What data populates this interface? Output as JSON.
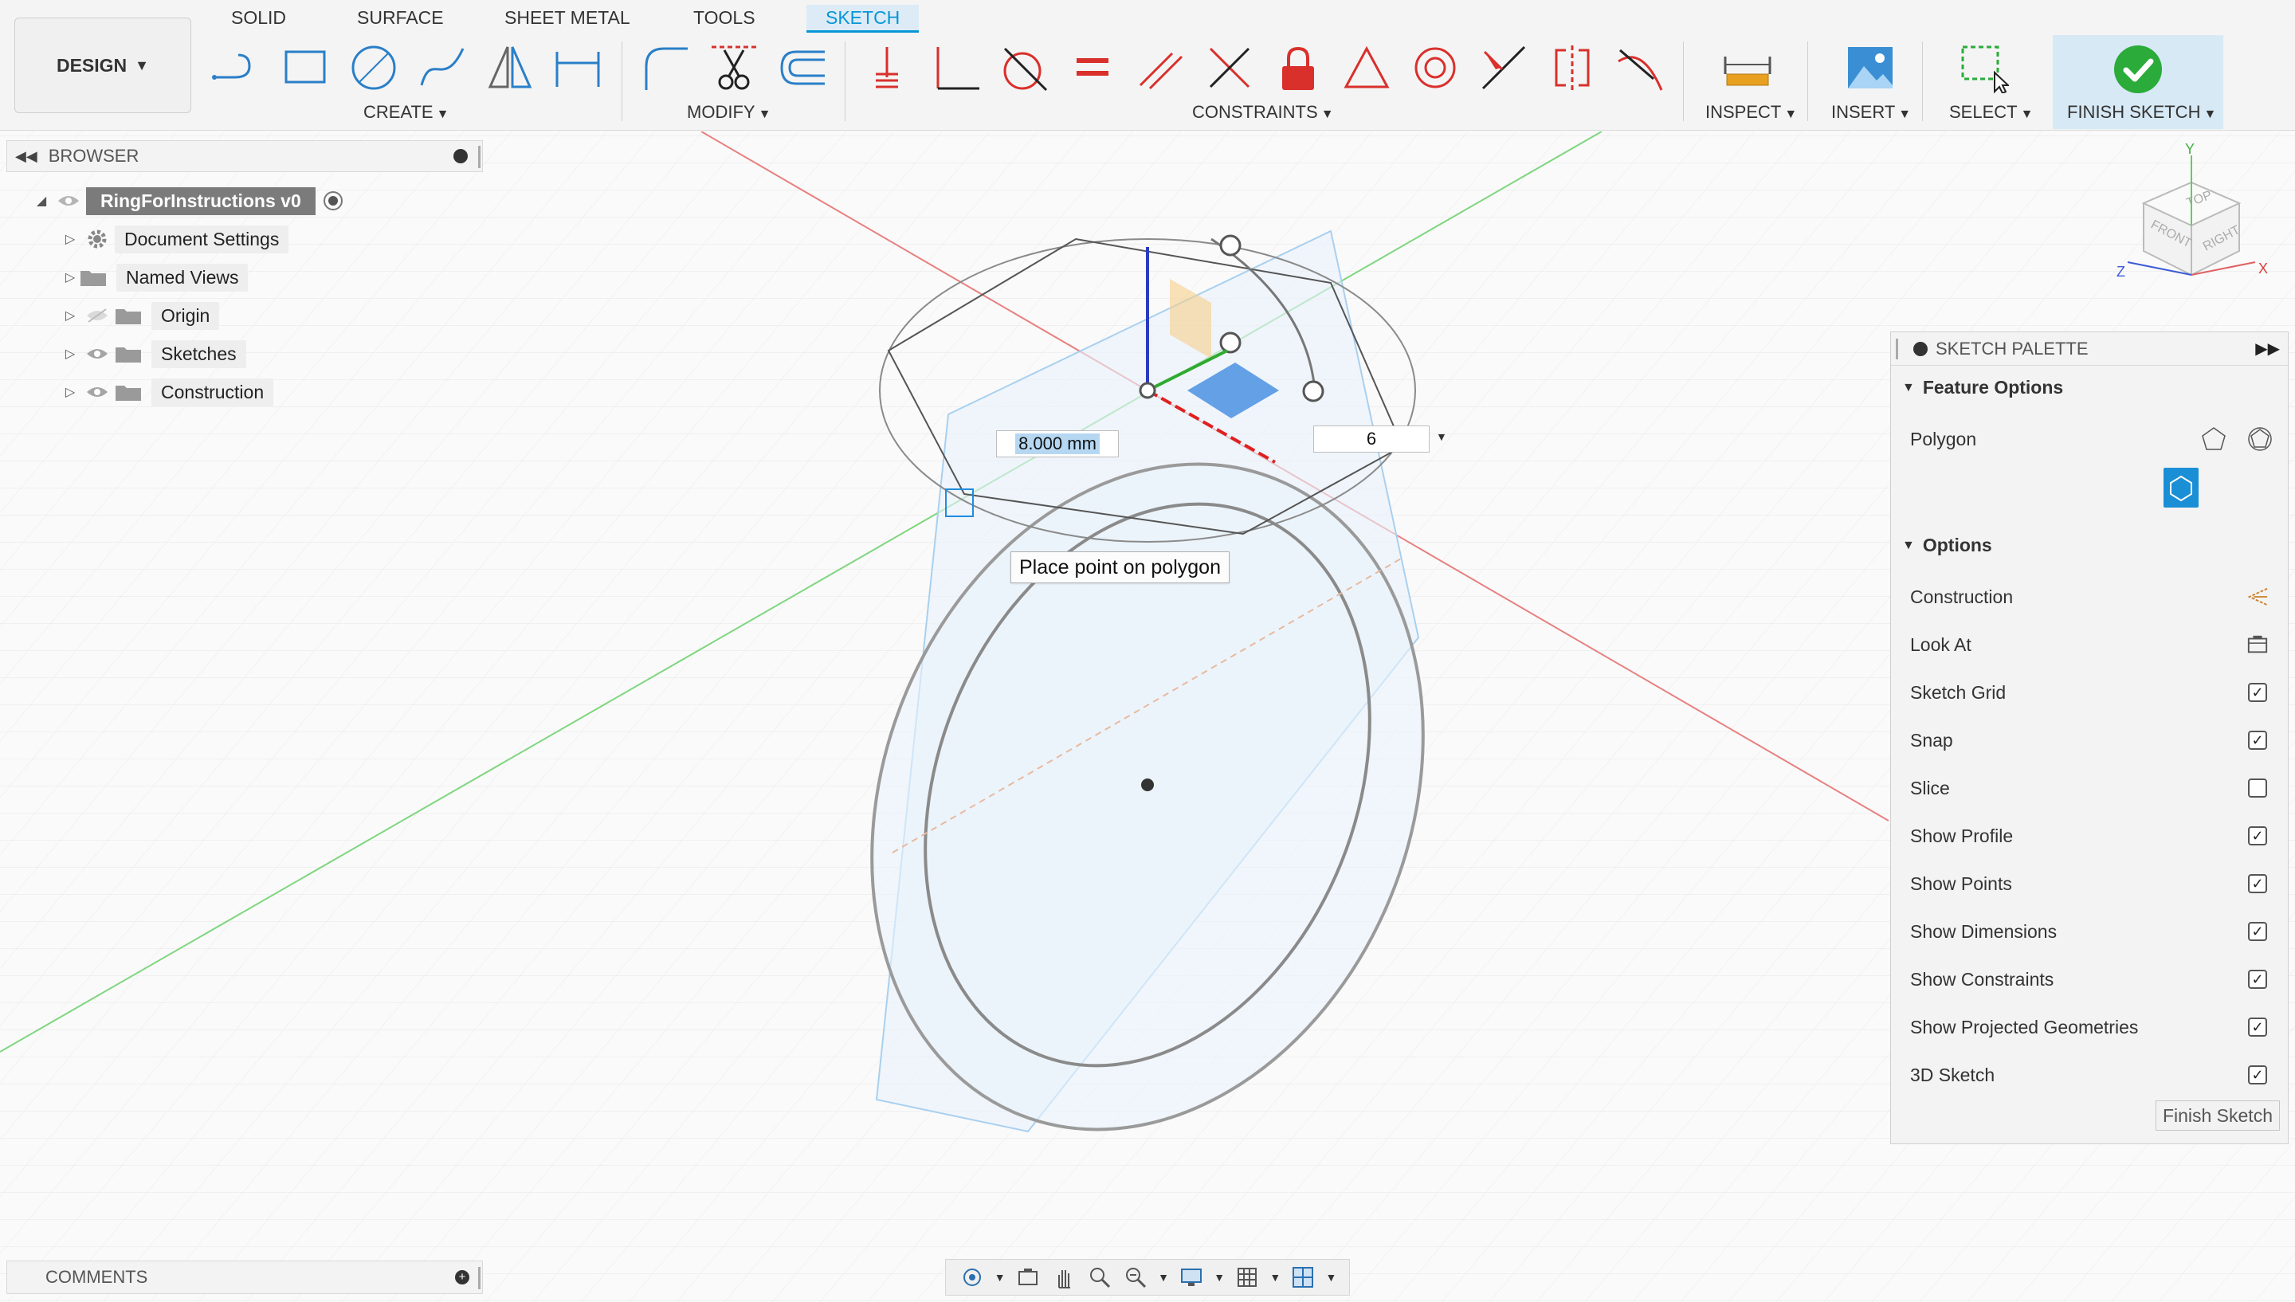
{
  "workspace": {
    "label": "DESIGN"
  },
  "tabs": [
    {
      "label": "SOLID"
    },
    {
      "label": "SURFACE"
    },
    {
      "label": "SHEET METAL"
    },
    {
      "label": "TOOLS"
    },
    {
      "label": "SKETCH",
      "active": true
    }
  ],
  "groups": {
    "create": "CREATE",
    "modify": "MODIFY",
    "constraints": "CONSTRAINTS",
    "inspect": "INSPECT",
    "insert": "INSERT",
    "select": "SELECT",
    "finish": "FINISH SKETCH"
  },
  "tools": {
    "create": [
      "line-icon",
      "rectangle-icon",
      "circle-icon",
      "spline-icon",
      "mirror-icon",
      "dimension-icon"
    ],
    "modify": [
      "fillet-icon",
      "trim-icon",
      "offset-icon"
    ],
    "constraints": [
      "coincident-icon",
      "perpendicular-icon",
      "tangent-icon",
      "equal-icon",
      "parallel-icon",
      "collinear-icon",
      "fix-icon",
      "triangle-icon",
      "concentric-icon",
      "midpoint-icon",
      "symmetry-icon",
      "curvature-icon"
    ]
  },
  "browser": {
    "title": "BROWSER",
    "root": "RingForInstructions v0",
    "items": [
      {
        "label": "Document Settings",
        "icon": "gear-icon"
      },
      {
        "label": "Named Views",
        "icon": "folder-icon"
      },
      {
        "label": "Origin",
        "icon": "folder-icon",
        "hidden": true
      },
      {
        "label": "Sketches",
        "icon": "folder-icon"
      },
      {
        "label": "Construction",
        "icon": "folder-icon"
      }
    ]
  },
  "comments": {
    "title": "COMMENTS"
  },
  "viewport": {
    "dimension_value": "8.000 mm",
    "sides_value": "6",
    "tooltip": "Place point on polygon"
  },
  "viewcube": {
    "top": "TOP",
    "front": "FRONT",
    "right": "RIGHT",
    "axis_x": "X",
    "axis_y": "Y",
    "axis_z": "Z"
  },
  "palette": {
    "title": "SKETCH PALETTE",
    "feature_options": "Feature Options",
    "polygon_label": "Polygon",
    "options_title": "Options",
    "options": [
      {
        "label": "Construction",
        "type": "icon",
        "icon": "construction-icon"
      },
      {
        "label": "Look At",
        "type": "icon",
        "icon": "look-at-icon"
      },
      {
        "label": "Sketch Grid",
        "type": "check",
        "checked": true
      },
      {
        "label": "Snap",
        "type": "check",
        "checked": true
      },
      {
        "label": "Slice",
        "type": "check",
        "checked": false
      },
      {
        "label": "Show Profile",
        "type": "check",
        "checked": true
      },
      {
        "label": "Show Points",
        "type": "check",
        "checked": true
      },
      {
        "label": "Show Dimensions",
        "type": "check",
        "checked": true
      },
      {
        "label": "Show Constraints",
        "type": "check",
        "checked": true
      },
      {
        "label": "Show Projected Geometries",
        "type": "check",
        "checked": true
      },
      {
        "label": "3D Sketch",
        "type": "check",
        "checked": true
      }
    ],
    "finish_button": "Finish Sketch"
  },
  "colors": {
    "accent": "#0696d7",
    "constraint_red": "#d9302c",
    "finish_green": "#2aab3a",
    "axis_x": "#e06060",
    "axis_y": "#5fcf5f",
    "axis_z": "#2b3bbf"
  }
}
